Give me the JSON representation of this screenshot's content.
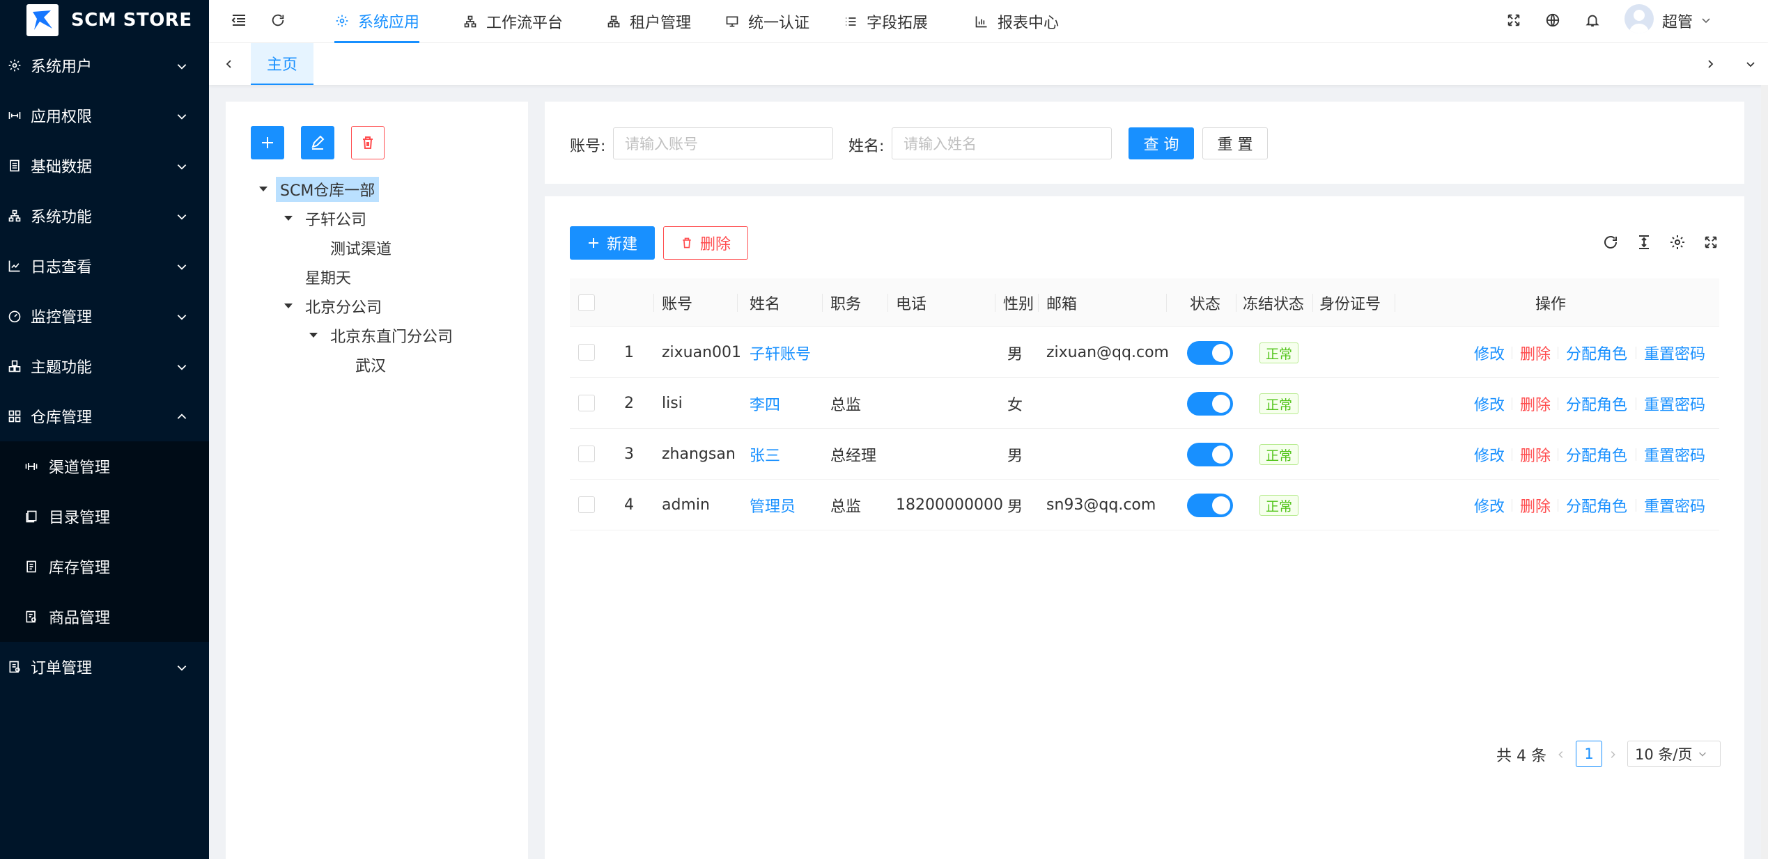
{
  "app": {
    "title": "SCM STORE"
  },
  "sidebar": {
    "items": [
      {
        "label": "系统用户",
        "icon": "gear-icon"
      },
      {
        "label": "应用权限",
        "icon": "permission-icon"
      },
      {
        "label": "基础数据",
        "icon": "database-icon"
      },
      {
        "label": "系统功能",
        "icon": "cluster-icon"
      },
      {
        "label": "日志查看",
        "icon": "chart-icon"
      },
      {
        "label": "监控管理",
        "icon": "dashboard-icon"
      },
      {
        "label": "主题功能",
        "icon": "theme-icon"
      },
      {
        "label": "仓库管理",
        "icon": "warehouse-icon",
        "expanded": true
      },
      {
        "label": "订单管理",
        "icon": "order-icon"
      }
    ],
    "sub_items": [
      {
        "label": "渠道管理",
        "icon": "channel-icon"
      },
      {
        "label": "目录管理",
        "icon": "catalog-icon"
      },
      {
        "label": "库存管理",
        "icon": "inventory-icon"
      },
      {
        "label": "商品管理",
        "icon": "product-icon"
      }
    ]
  },
  "header": {
    "tabs": [
      {
        "label": "系统应用",
        "icon": "gear-icon",
        "active": true
      },
      {
        "label": "工作流平台",
        "icon": "workflow-icon"
      },
      {
        "label": "租户管理",
        "icon": "tenant-icon"
      },
      {
        "label": "统一认证",
        "icon": "monitor-icon"
      },
      {
        "label": "字段拓展",
        "icon": "list-icon"
      },
      {
        "label": "报表中心",
        "icon": "bar-chart-icon"
      }
    ],
    "user_name": "超管"
  },
  "tabbar": {
    "home_label": "主页"
  },
  "tree": {
    "nodes": [
      {
        "label": "SCM仓库一部",
        "selected": true
      },
      {
        "label": "子轩公司"
      },
      {
        "label": "测试渠道"
      },
      {
        "label": "星期天"
      },
      {
        "label": "北京分公司"
      },
      {
        "label": "北京东直门分公司"
      },
      {
        "label": "武汉"
      }
    ]
  },
  "search": {
    "account_label": "账号:",
    "account_placeholder": "请输入账号",
    "name_label": "姓名:",
    "name_placeholder": "请输入姓名",
    "query_label": "查 询",
    "reset_label": "重 置"
  },
  "toolbar": {
    "new_label": "新建",
    "delete_label": "删除"
  },
  "table": {
    "columns": [
      "账号",
      "姓名",
      "职务",
      "电话",
      "性别",
      "邮箱",
      "状态",
      "冻结状态",
      "身份证号",
      "操作"
    ],
    "rows": [
      {
        "index": "1",
        "account": "zixuan001",
        "name": "子轩账号",
        "title": "",
        "phone": "",
        "gender": "男",
        "email": "zixuan@qq.com",
        "status_on": true,
        "freeze": "正常",
        "id_no": ""
      },
      {
        "index": "2",
        "account": "lisi",
        "name": "李四",
        "title": "总监",
        "phone": "",
        "gender": "女",
        "email": "",
        "status_on": true,
        "freeze": "正常",
        "id_no": ""
      },
      {
        "index": "3",
        "account": "zhangsan",
        "name": "张三",
        "title": "总经理",
        "phone": "",
        "gender": "男",
        "email": "",
        "status_on": true,
        "freeze": "正常",
        "id_no": ""
      },
      {
        "index": "4",
        "account": "admin",
        "name": "管理员",
        "title": "总监",
        "phone": "18200000000",
        "gender": "男",
        "email": "sn93@qq.com",
        "status_on": true,
        "freeze": "正常",
        "id_no": ""
      }
    ],
    "actions": {
      "edit": "修改",
      "delete": "删除",
      "assign_role": "分配角色",
      "reset_password": "重置密码"
    }
  },
  "pagination": {
    "total_text": "共 4 条",
    "current_page": "1",
    "page_size": "10 条/页"
  },
  "colors": {
    "primary": "#1890ff",
    "danger": "#ff4d4f",
    "success": "#52c41a",
    "sidebar_bg": "#001529"
  }
}
